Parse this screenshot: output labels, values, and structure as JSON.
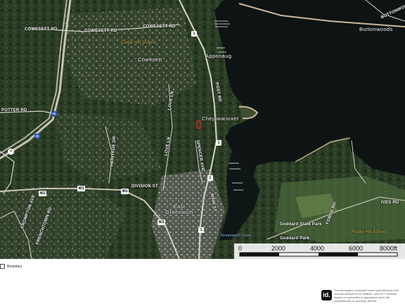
{
  "map": {
    "labels": {
      "cowesett_rd": "COWESETT RD",
      "cowesett_rd_2": "COWESETT RD",
      "cowesett_rd_3": "COWESETT RD",
      "cedar_hill_school": "Cedar Hill School",
      "cowesett": "Cowesett",
      "buttonwoods": "Buttonwoods",
      "buttonwoods_rd": "BUTTONWOODS",
      "potter_rd": "POTTER RD",
      "love_ln": "LOVE LN",
      "love_ln_2": "LOVE LN",
      "heritage_dr": "HERITAGE DR",
      "spencer_ave": "SPENCER AVE",
      "post_rd": "POST RD",
      "chepiwanoxet": "Chepiwanoxet",
      "apponaug": "Apponaug",
      "division_st": "DIVISION ST",
      "east_greenwich": "East Greenwich",
      "main_st": "MAIN ST",
      "crompton_ave": "CROMPTON AVE",
      "frenchtown_rd": "FRENCHTOWN RD",
      "greenwich_cove": "Greenwich Cove",
      "goddard_state_park": "Goddard State Park",
      "goddard_park": "Goddard Park",
      "rocky_hill_school": "Rocky Hill School",
      "ives_rd": "IVES RD",
      "forge_rd": "FORGE RD"
    },
    "shields": {
      "us1_a": "1",
      "us1_b": "1",
      "us1_c": "1",
      "us1_d": "1",
      "i95_a": "95",
      "i95_b": "95",
      "ri4": "4",
      "ri401_a": "401",
      "ri401_b": "401",
      "ri401_c": "401",
      "ri401_d": "401"
    },
    "colors": {
      "water": "#0d1413",
      "land": "#2a3a24",
      "boundary": "#e02020"
    }
  },
  "scale": {
    "ticks": [
      "0",
      "2000",
      "4000",
      "6000",
      "8000ft"
    ]
  },
  "legend": {
    "label": "Boundary",
    "swatch_icon": "boundary-swatch-icon"
  },
  "footer": {
    "logo_text": "id.",
    "disclaimer": "The information contained herein was obtained from sources deemed to be reliable. Land id™ Services makes no warranties or guarantees as to the completeness or accuracy thereof."
  }
}
